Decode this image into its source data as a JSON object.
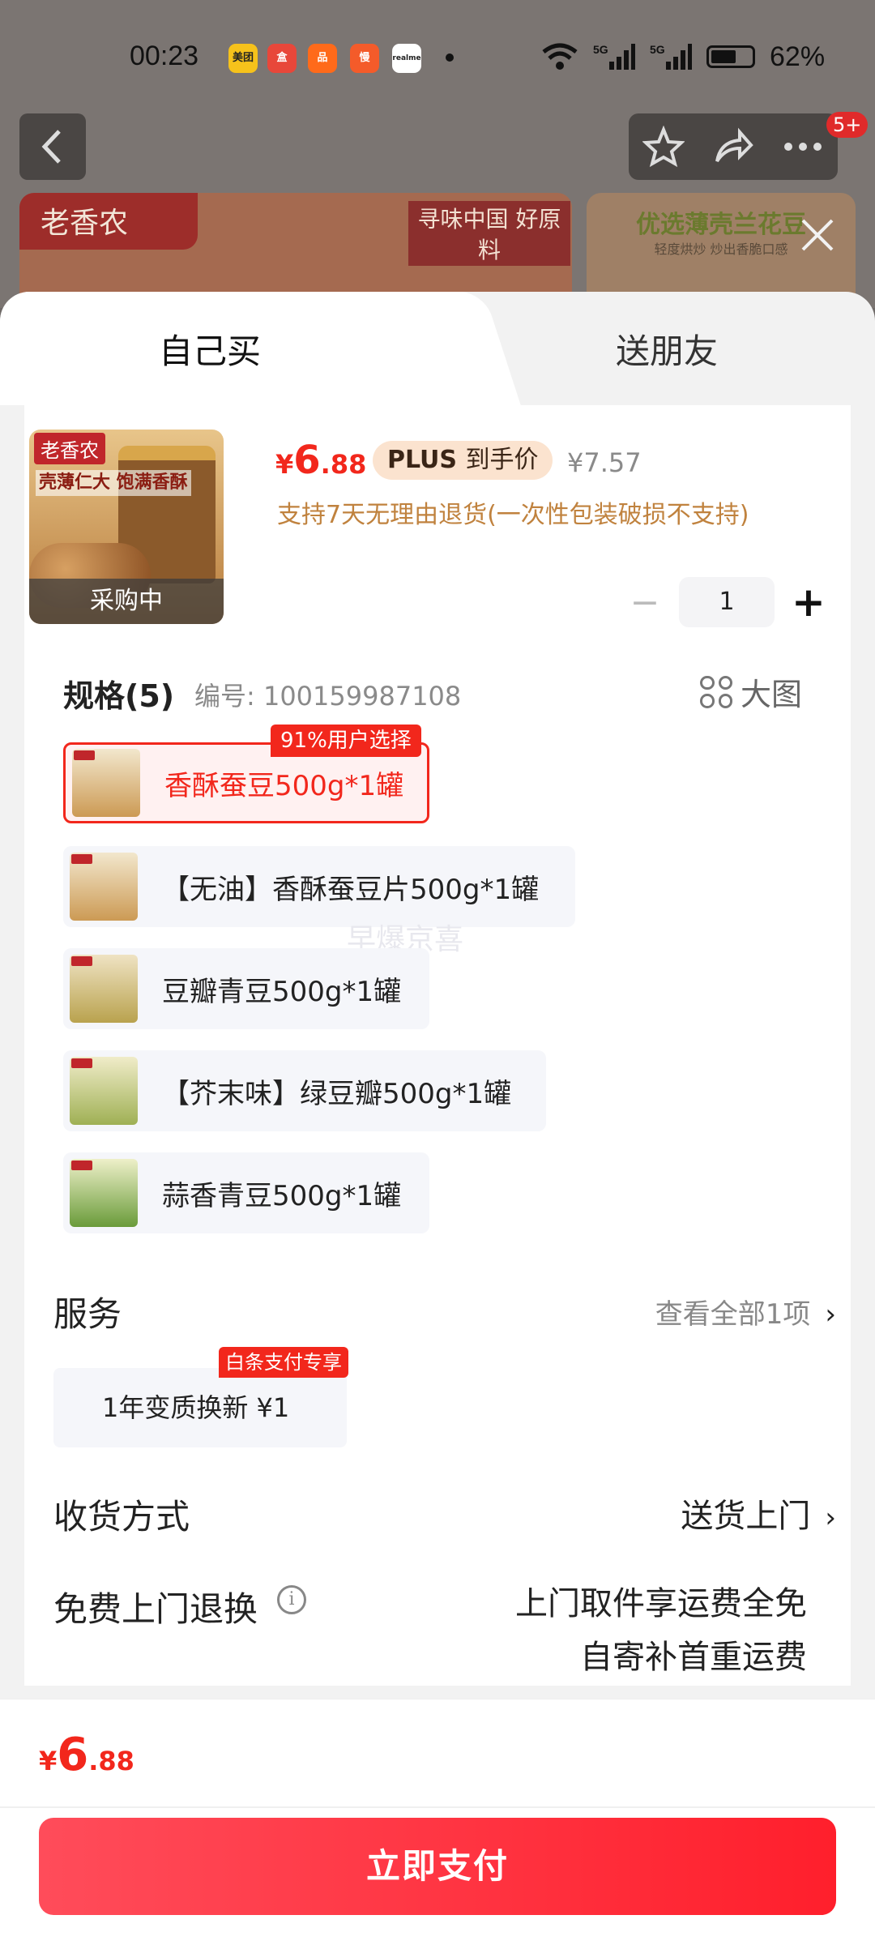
{
  "status_bar": {
    "time": "00:23",
    "apps": [
      "美团",
      "盒",
      "品",
      "慢",
      "realme"
    ],
    "network": [
      "5G",
      "5G"
    ],
    "battery": "62%"
  },
  "background": {
    "banner_left_brand": "老香农",
    "banner_left_slogan": "寻味中国 好原料",
    "banner_right_title": "优选薄壳兰花豆",
    "banner_right_sub": "轻度烘炒 炒出香脆口感",
    "cart_badge": "5+"
  },
  "tabs": {
    "self": "自己买",
    "gift": "送朋友"
  },
  "product": {
    "image_brand": "老香农",
    "image_text": "壳薄仁大 饱满香酥",
    "status_overlay": "采购中",
    "price_symbol": "¥",
    "price_int": "6",
    "price_dec": ".88",
    "plus_label": "PLUS",
    "plus_suffix": "到手价",
    "original_price": "¥7.57",
    "return_policy": "支持7天无理由退货(一次性包装破损不支持)"
  },
  "quantity": {
    "minus": "−",
    "value": "1",
    "plus": "+"
  },
  "spec": {
    "title": "规格(5)",
    "code": "编号: 100159987108",
    "big_image": "大图",
    "popular_tag": "91%用户选择",
    "options": [
      "香酥蚕豆500g*1罐",
      "【无油】香酥蚕豆片500g*1罐",
      "豆瓣青豆500g*1罐",
      "【芥末味】绿豆瓣500g*1罐",
      "蒜香青豆500g*1罐"
    ],
    "watermark": "早爆京喜"
  },
  "service": {
    "title": "服务",
    "view_all": "查看全部1项",
    "card_label": "1年变质换新  ¥1",
    "card_tag": "白条支付专享"
  },
  "delivery": {
    "title": "收货方式",
    "value": "送货上门"
  },
  "free_return": {
    "title": "免费上门退换",
    "line1": "上门取件享运费全免",
    "line2": "自寄补首重运费"
  },
  "footer": {
    "price_symbol": "¥",
    "price_int": "6",
    "price_dec": ".88",
    "pay_button": "立即支付"
  },
  "colors": {
    "accent": "#f2271c",
    "policy": "#c0823e",
    "plus_bg": "#fbe3cf"
  }
}
